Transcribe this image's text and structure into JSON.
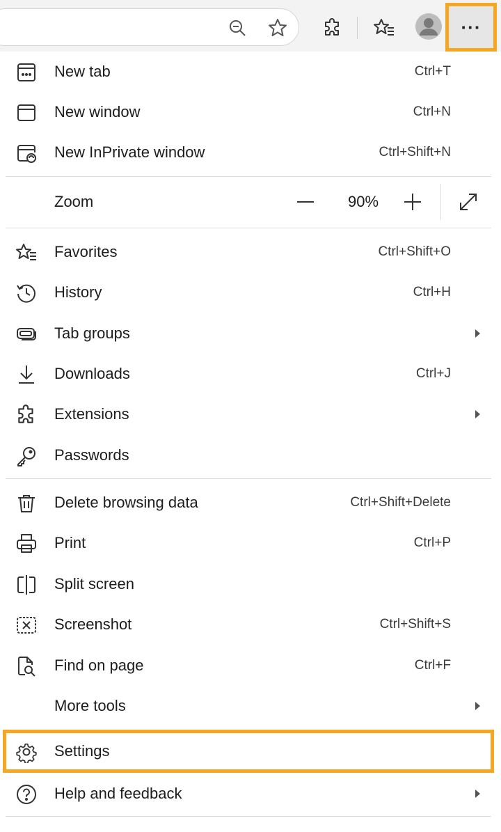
{
  "toolbar": {
    "icons": [
      "zoom-out-icon",
      "favorite-star-icon",
      "extensions-icon",
      "favorites-list-icon",
      "profile-avatar-icon"
    ],
    "more_label": "···"
  },
  "menu": {
    "new_tab": {
      "label": "New tab",
      "shortcut": "Ctrl+T"
    },
    "new_window": {
      "label": "New window",
      "shortcut": "Ctrl+N"
    },
    "new_inprivate": {
      "label": "New InPrivate window",
      "shortcut": "Ctrl+Shift+N"
    },
    "zoom": {
      "label": "Zoom",
      "value": "90%"
    },
    "favorites": {
      "label": "Favorites",
      "shortcut": "Ctrl+Shift+O"
    },
    "history": {
      "label": "History",
      "shortcut": "Ctrl+H"
    },
    "tab_groups": {
      "label": "Tab groups"
    },
    "downloads": {
      "label": "Downloads",
      "shortcut": "Ctrl+J"
    },
    "extensions": {
      "label": "Extensions"
    },
    "passwords": {
      "label": "Passwords"
    },
    "delete_browsing": {
      "label": "Delete browsing data",
      "shortcut": "Ctrl+Shift+Delete"
    },
    "print": {
      "label": "Print",
      "shortcut": "Ctrl+P"
    },
    "split_screen": {
      "label": "Split screen"
    },
    "screenshot": {
      "label": "Screenshot",
      "shortcut": "Ctrl+Shift+S"
    },
    "find_on_page": {
      "label": "Find on page",
      "shortcut": "Ctrl+F"
    },
    "more_tools": {
      "label": "More tools"
    },
    "settings": {
      "label": "Settings"
    },
    "help": {
      "label": "Help and feedback"
    }
  },
  "colors": {
    "highlight": "#f5a623",
    "toolbar_bg": "#f3f3f3",
    "menu_bg": "#ffffff"
  }
}
